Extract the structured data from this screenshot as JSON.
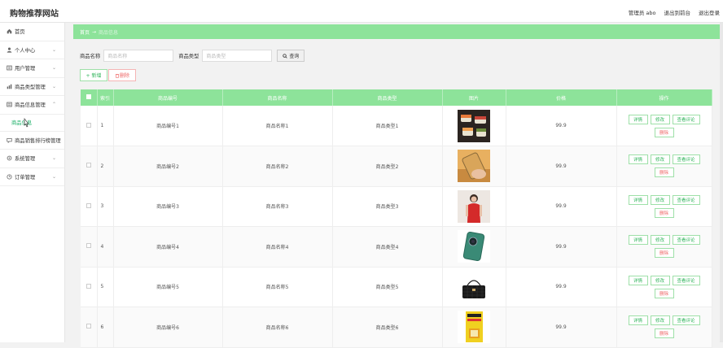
{
  "header": {
    "site_title": "购物推荐网站",
    "admin_label": "管理员 abo",
    "back_label": "退出到前台",
    "logout_label": "退出登录"
  },
  "sidebar": {
    "items": [
      {
        "label": "首页",
        "icon": "home-icon"
      },
      {
        "label": "个人中心",
        "icon": "user-icon"
      },
      {
        "label": "用户管理",
        "icon": "users-icon"
      },
      {
        "label": "商品类型管理",
        "icon": "category-icon"
      },
      {
        "label": "商品信息管理",
        "icon": "list-icon"
      }
    ],
    "sub_item": "商品信息",
    "items_after": [
      {
        "label": "商品销售排行榜管理",
        "icon": "rank-icon"
      },
      {
        "label": "系统管理",
        "icon": "gear-icon"
      },
      {
        "label": "订单管理",
        "icon": "order-icon"
      }
    ]
  },
  "breadcrumb": {
    "home": "首页",
    "separator": "→",
    "current": "商品信息"
  },
  "search": {
    "name_label": "商品名称",
    "name_placeholder": "商品名称",
    "type_label": "商品类型",
    "type_placeholder": "商品类型",
    "query_button": "查询"
  },
  "actions": {
    "add_button": "+ 新增",
    "delete_button": "删除"
  },
  "table": {
    "headers": [
      "索引",
      "商品编号",
      "商品名称",
      "商品类型",
      "图片",
      "价格",
      "操作"
    ],
    "rows": [
      {
        "index": "1",
        "code": "商品编号1",
        "name": "商品名称1",
        "type": "商品类型1",
        "price": "99.9",
        "image": "sushi"
      },
      {
        "index": "2",
        "code": "商品编号2",
        "name": "商品名称2",
        "type": "商品类型2",
        "price": "99.9",
        "image": "phone-hand"
      },
      {
        "index": "3",
        "code": "商品编号3",
        "name": "商品名称3",
        "type": "商品类型3",
        "price": "99.9",
        "image": "woman-red"
      },
      {
        "index": "4",
        "code": "商品编号4",
        "name": "商品名称4",
        "type": "商品类型4",
        "price": "99.9",
        "image": "phone-green"
      },
      {
        "index": "5",
        "code": "商品编号5",
        "name": "商品名称5",
        "type": "商品类型5",
        "price": "99.9",
        "image": "handbag"
      },
      {
        "index": "6",
        "code": "商品编号6",
        "name": "商品名称6",
        "type": "商品类型6",
        "price": "99.9",
        "image": "book"
      }
    ],
    "op_labels": {
      "detail": "详情",
      "edit": "修改",
      "review": "查看评论",
      "delete": "删除"
    }
  },
  "colors": {
    "accent": "#8de39a",
    "success": "#2fb45a",
    "danger": "#ee6666"
  }
}
